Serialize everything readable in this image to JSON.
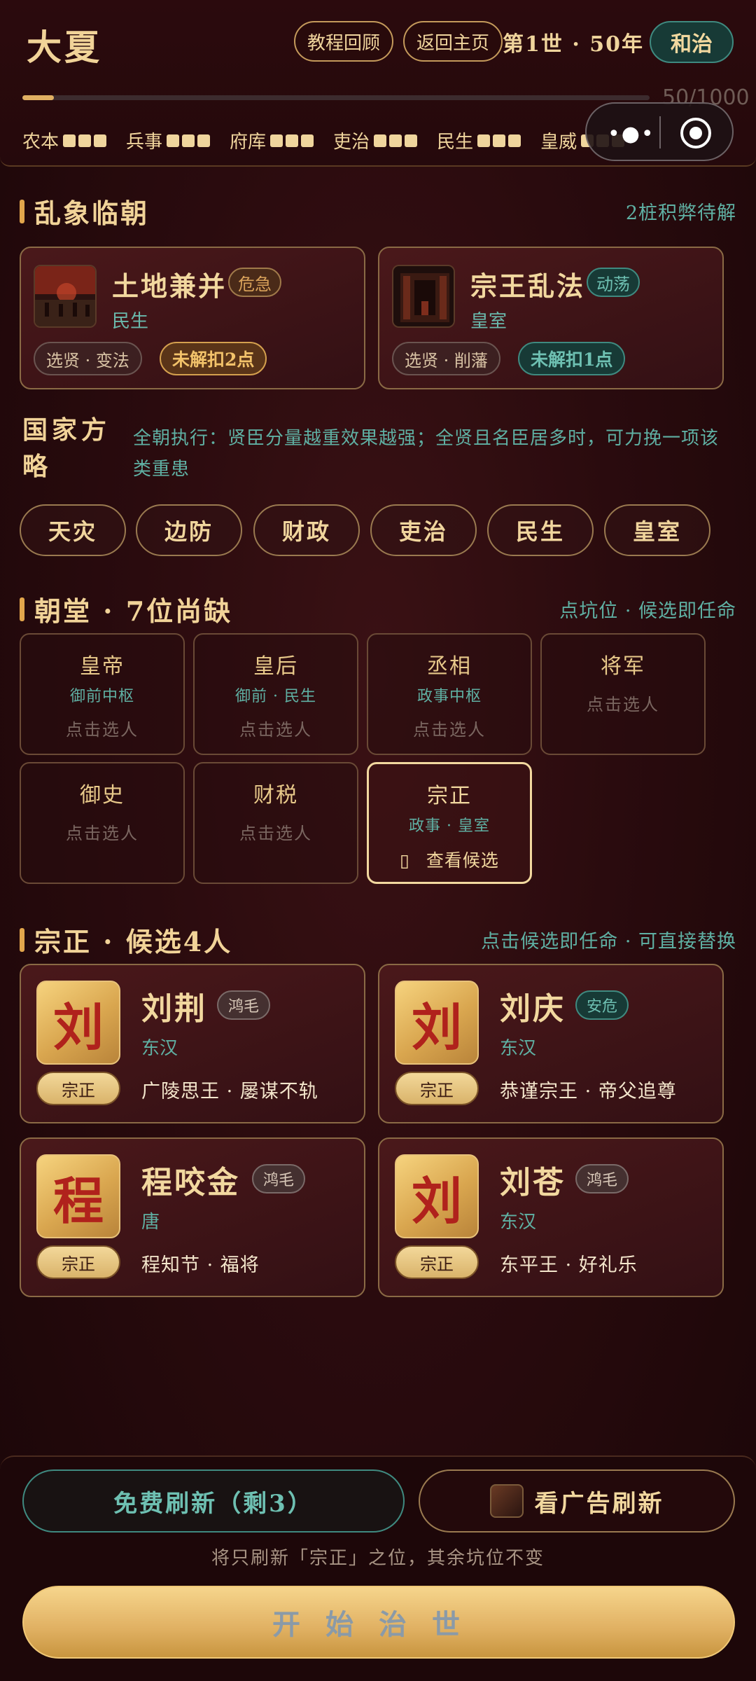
{
  "header": {
    "title": "大夏",
    "tutorial_label": "教程回顾",
    "home_label": "返回主页",
    "life_text": "第1世 · 50年",
    "state_badge": "和治",
    "progress_text": "50/1000",
    "progress_value": 0.05,
    "stats": [
      {
        "label": "农本",
        "level": 3
      },
      {
        "label": "兵事",
        "level": 3
      },
      {
        "label": "府库",
        "level": 3
      },
      {
        "label": "吏治",
        "level": 3
      },
      {
        "label": "民生",
        "level": 3
      },
      {
        "label": "皇威",
        "level": 3
      }
    ],
    "menu_dots": "•●•"
  },
  "crisis": {
    "title": "乱象临朝",
    "hint": "2桩积弊待解",
    "cards": [
      {
        "name": "土地兼并",
        "badge": "危急",
        "category": "民生",
        "tag": "选贤 · 变法",
        "status": "未解扣2点"
      },
      {
        "name": "宗王乱法",
        "badge": "动荡",
        "category": "皇室",
        "tag": "选贤 · 削藩",
        "status": "未解扣1点"
      }
    ]
  },
  "strategy": {
    "title": "国家方略",
    "description": "全朝执行：贤臣分量越重效果越强；全贤且名臣居多时，可力挽一项该类重患",
    "categories": [
      "天灾",
      "边防",
      "财政",
      "吏治",
      "民生",
      "皇室"
    ]
  },
  "court": {
    "title": "朝堂 · 7位尚缺",
    "hint": "点坑位 · 候选即任命",
    "pick_label": "点击选人",
    "slots": [
      {
        "title": "皇帝",
        "sub": "御前中枢"
      },
      {
        "title": "皇后",
        "sub": "御前 · 民生"
      },
      {
        "title": "丞相",
        "sub": "政事中枢"
      },
      {
        "title": "将军",
        "sub": ""
      },
      {
        "title": "御史",
        "sub": ""
      },
      {
        "title": "财税",
        "sub": ""
      },
      {
        "title": "宗正",
        "sub": "政事 · 皇室",
        "action": "查看候选",
        "action_icon": "▯"
      }
    ]
  },
  "candidates": {
    "title": "宗正 · 候选4人",
    "hint": "点击候选即任命 · 可直接替换",
    "list": [
      {
        "glyph": "刘",
        "name": "刘荆",
        "badge": "鸿毛",
        "badge_style": "gray",
        "era": "东汉",
        "role": "宗正",
        "desc": "广陵思王 · 屡谋不轨"
      },
      {
        "glyph": "刘",
        "name": "刘庆",
        "badge": "安危",
        "badge_style": "teal",
        "era": "东汉",
        "role": "宗正",
        "desc": "恭谨宗王 · 帝父追尊"
      },
      {
        "glyph": "程",
        "name": "程咬金",
        "badge": "鸿毛",
        "badge_style": "gray",
        "era": "唐",
        "role": "宗正",
        "desc": "程知节 · 福将"
      },
      {
        "glyph": "刘",
        "name": "刘苍",
        "badge": "鸿毛",
        "badge_style": "gray",
        "era": "东汉",
        "role": "宗正",
        "desc": "东平王 · 好礼乐"
      }
    ]
  },
  "bottom": {
    "free_refresh": "免费刷新（剩3）",
    "ad_refresh": "看广告刷新",
    "note": "将只刷新「宗正」之位，其余坑位不变",
    "start": "开始治世"
  },
  "colors": {
    "gold": "#f2d89f",
    "teal": "#5fb0a3",
    "background": "#2a0b0e",
    "urgent": "#e0b063"
  }
}
